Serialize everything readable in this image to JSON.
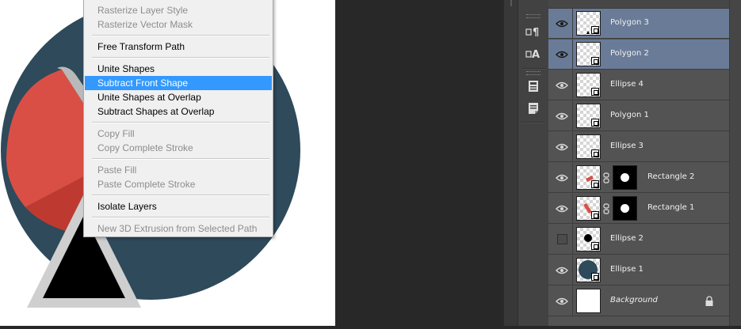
{
  "context_menu": {
    "items": [
      {
        "label": "Rasterize Layer Style",
        "enabled": false,
        "highlighted": false
      },
      {
        "label": "Rasterize Vector Mask",
        "enabled": false,
        "highlighted": false
      },
      {
        "label": "Free Transform Path",
        "enabled": true,
        "highlighted": false
      },
      {
        "label": "Unite Shapes",
        "enabled": true,
        "highlighted": false
      },
      {
        "label": "Subtract Front Shape",
        "enabled": true,
        "highlighted": true
      },
      {
        "label": "Unite Shapes at Overlap",
        "enabled": true,
        "highlighted": false
      },
      {
        "label": "Subtract Shapes at Overlap",
        "enabled": true,
        "highlighted": false
      },
      {
        "label": "Copy Fill",
        "enabled": false,
        "highlighted": false
      },
      {
        "label": "Copy Complete Stroke",
        "enabled": false,
        "highlighted": false
      },
      {
        "label": "Paste Fill",
        "enabled": false,
        "highlighted": false
      },
      {
        "label": "Paste Complete Stroke",
        "enabled": false,
        "highlighted": false
      },
      {
        "label": "Isolate Layers",
        "enabled": true,
        "highlighted": false
      },
      {
        "label": "New 3D Extrusion from Selected Path",
        "enabled": false,
        "highlighted": false
      }
    ]
  },
  "layers": [
    {
      "name": "Polygon 3",
      "visible": true,
      "selected": true,
      "has_mask": false
    },
    {
      "name": "Polygon 2",
      "visible": true,
      "selected": true,
      "has_mask": false
    },
    {
      "name": "Ellipse 4",
      "visible": true,
      "selected": false,
      "has_mask": false
    },
    {
      "name": "Polygon 1",
      "visible": true,
      "selected": false,
      "has_mask": false
    },
    {
      "name": "Ellipse 3",
      "visible": true,
      "selected": false,
      "has_mask": false
    },
    {
      "name": "Rectangle 2",
      "visible": true,
      "selected": false,
      "has_mask": true
    },
    {
      "name": "Rectangle 1",
      "visible": true,
      "selected": false,
      "has_mask": true
    },
    {
      "name": "Ellipse 2",
      "visible": false,
      "selected": false,
      "has_mask": false
    },
    {
      "name": "Ellipse 1",
      "visible": true,
      "selected": false,
      "has_mask": false
    },
    {
      "name": "Background",
      "visible": true,
      "selected": false,
      "has_mask": false,
      "locked": true
    }
  ],
  "side_strip_icons": [
    "paragraph-icon",
    "character-icon",
    "properties-icon",
    "notes-icon"
  ],
  "colors": {
    "canvas_circle": "#2e4a5b",
    "shape_red_light": "#d94f45",
    "shape_red_dark": "#be3a30",
    "shape_gray": "#c9c9c9",
    "triangle_border": "#cfcfcf",
    "triangle_fill": "#000000",
    "menu_highlight": "#3399ff",
    "layer_selected": "#6a7b98",
    "panel_bg": "#535353"
  }
}
